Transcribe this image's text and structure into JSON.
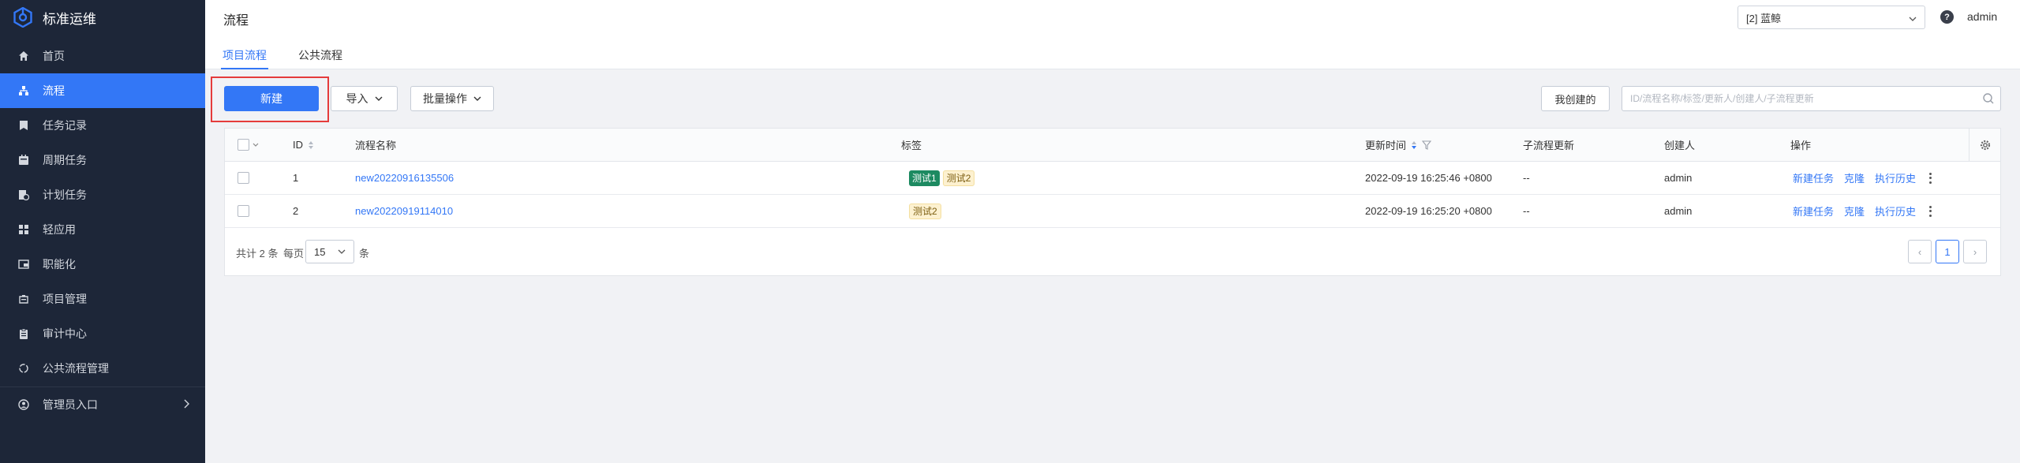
{
  "sidebar": {
    "brand_name": "标准运维",
    "items": [
      {
        "label": "首页"
      },
      {
        "label": "流程"
      },
      {
        "label": "任务记录"
      },
      {
        "label": "周期任务"
      },
      {
        "label": "计划任务"
      },
      {
        "label": "轻应用"
      },
      {
        "label": "职能化"
      },
      {
        "label": "项目管理"
      },
      {
        "label": "审计中心"
      },
      {
        "label": "公共流程管理"
      }
    ],
    "admin_entry": "管理员入口",
    "active_index": 1
  },
  "header": {
    "title": "流程",
    "tabs": [
      {
        "label": "项目流程"
      },
      {
        "label": "公共流程"
      }
    ],
    "project_select": "[2] 蓝鲸",
    "help_icon": "?",
    "user": "admin"
  },
  "toolbar": {
    "new_label": "新建",
    "import_label": "导入",
    "batch_label": "批量操作",
    "mine_label": "我创建的",
    "search_placeholder": "ID/流程名称/标签/更新人/创建人/子流程更新"
  },
  "table": {
    "headers": {
      "id": "ID",
      "name": "流程名称",
      "tags": "标签",
      "updated": "更新时间",
      "sub_update": "子流程更新",
      "creator": "创建人",
      "actions": "操作"
    },
    "rows": [
      {
        "id": "1",
        "name": "new20220916135506",
        "tags": [
          "测试1",
          "测试2"
        ],
        "updated": "2022-09-19 16:25:46 +0800",
        "sub_update": "--",
        "creator": "admin"
      },
      {
        "id": "2",
        "name": "new20220919114010",
        "tags": [
          "测试2"
        ],
        "updated": "2022-09-19 16:25:20 +0800",
        "sub_update": "--",
        "creator": "admin"
      }
    ],
    "actions": {
      "new_task": "新建任务",
      "clone": "克隆",
      "history": "执行历史"
    }
  },
  "pagination": {
    "total_text": "共计 2 条",
    "per_page_label": "每页",
    "page_size": "15",
    "unit": "条",
    "current_page": "1",
    "prev": "‹",
    "next": "›"
  },
  "colors": {
    "accent": "#3377f6",
    "sidebar_bg": "#1d2638",
    "tag_green": "#1d8a61",
    "highlight": "#e53b3b"
  }
}
